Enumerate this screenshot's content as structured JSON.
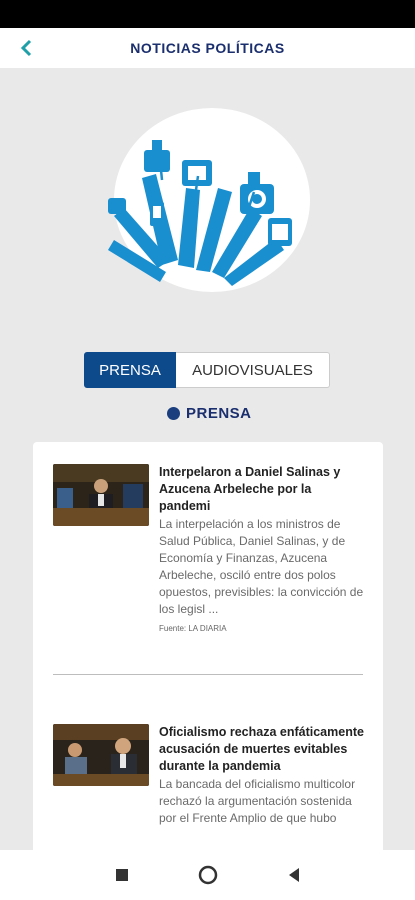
{
  "header": {
    "title": "NOTICIAS POLÍTICAS",
    "back_icon": "chevron-left-icon"
  },
  "tabs": [
    {
      "label": "PRENSA",
      "active": true
    },
    {
      "label": "AUDIOVISUALES",
      "active": false
    }
  ],
  "section": {
    "label": "PRENSA"
  },
  "news": [
    {
      "title": "Interpelaron a Daniel Salinas y Azucena Arbeleche por la pandemi",
      "summary": "La interpelación a los ministros de Salud Pública, Daniel Salinas, y de Economía y Finanzas, Azucena Arbeleche, osciló entre dos polos opuestos, previsibles: la convicción de los legisl ...",
      "source": "Fuente: LA DIARIA"
    },
    {
      "title": "Oficialismo rechaza enfáticamente acusación de muertes evitables durante la pandemia",
      "summary": "La bancada del oficialismo multicolor rechazó la argumentación sostenida por el Frente Amplio de que hubo"
    }
  ],
  "colors": {
    "brand": "#1b2f6e",
    "accent": "#0d4a8c",
    "back_arrow": "#1fa0a8",
    "hero_blue": "#1a8fd0"
  }
}
